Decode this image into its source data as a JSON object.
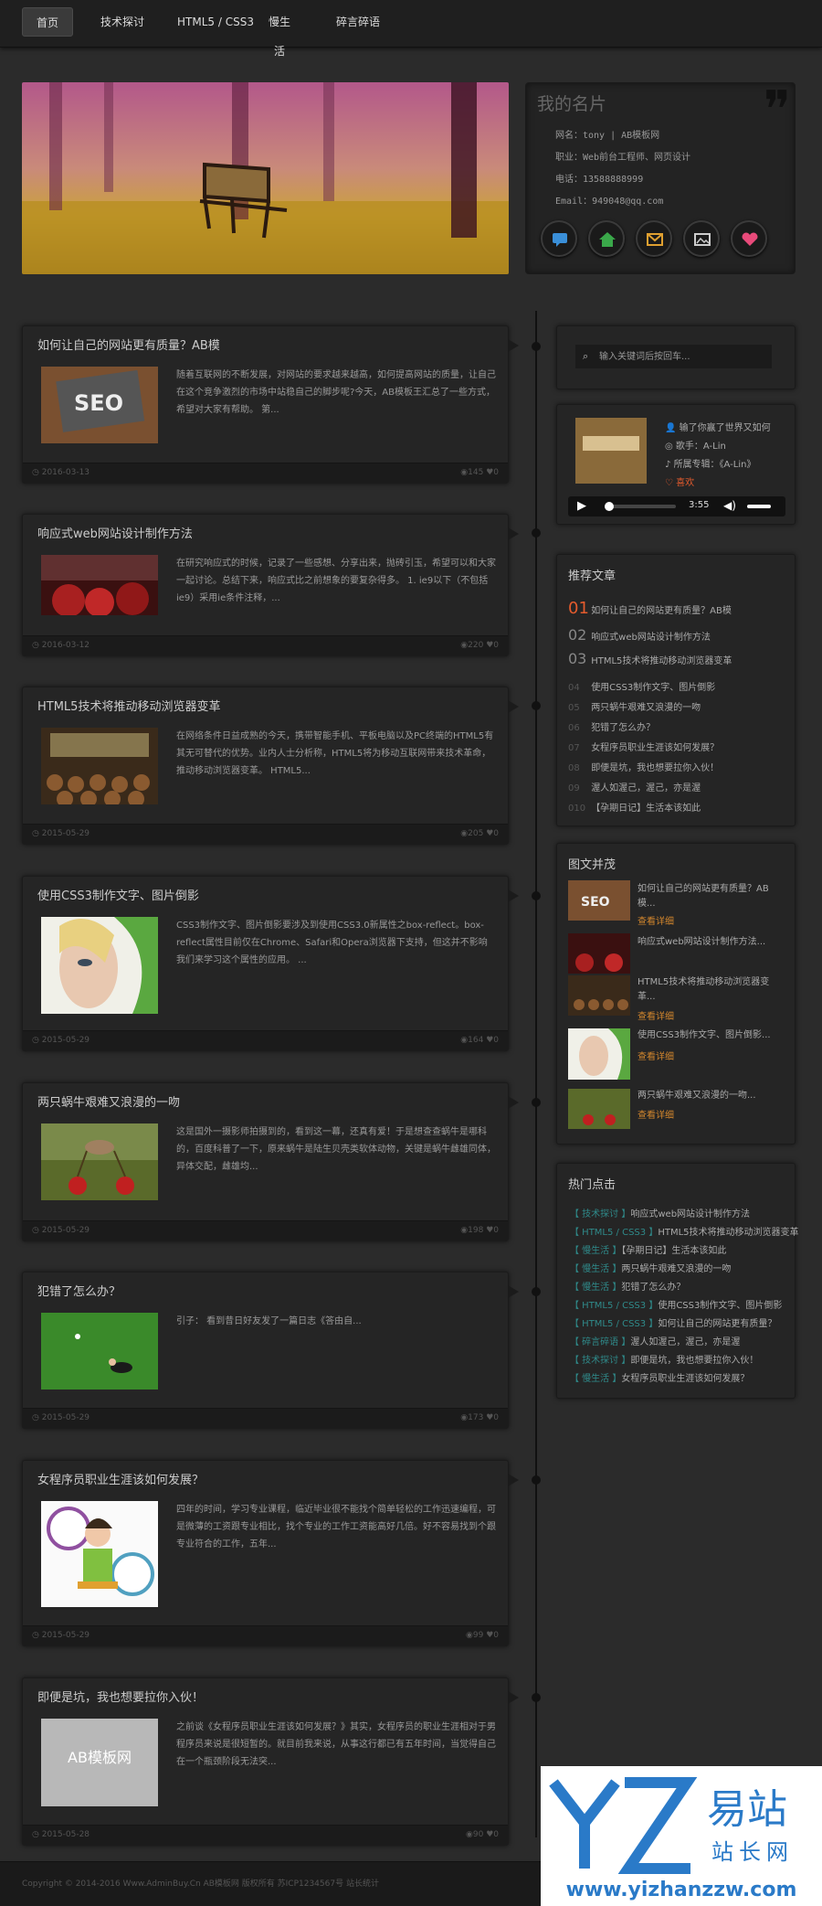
{
  "nav": {
    "items": [
      "首页",
      "技术探讨",
      "HTML5 / CSS3",
      "慢生活",
      "碎言碎语"
    ]
  },
  "profile": {
    "title": "我的名片",
    "name": "网名：tony | AB模板网",
    "job": "职业：Web前台工程师、网页设计",
    "phone": "电话：13588888999",
    "email": "Email：949048@qq.com"
  },
  "posts": [
    {
      "title": "如何让自己的网站更有质量？AB模",
      "desc": "随着互联网的不断发展，对网站的要求越来越高，如何提高网站的质量，让自己在这个竞争激烈的市场中站稳自己的脚步呢?今天，AB模板王汇总了一些方式，希望对大家有帮助。 第...",
      "date": "2016-03-13",
      "views": "145",
      "likes": "0"
    },
    {
      "title": "响应式web网站设计制作方法",
      "desc": "在研究响应式的时候，记录了一些感想、分享出来，抛砖引玉，希望可以和大家一起讨论。总结下来，响应式比之前想象的要复杂得多。 1. ie9以下（不包括ie9）采用ie条件注释，...",
      "date": "2016-03-12",
      "views": "220",
      "likes": "0"
    },
    {
      "title": "HTML5技术将推动移动浏览器变革",
      "desc": "在网络条件日益成熟的今天，携带智能手机、平板电脑以及PC终端的HTML5有其无可替代的优势。业内人士分析称，HTML5将为移动互联网带来技术革命，推动移动浏览器变革。 HTML5...",
      "date": "2015-05-29",
      "views": "205",
      "likes": "0"
    },
    {
      "title": "使用CSS3制作文字、图片倒影",
      "desc": "CSS3制作文字、图片倒影要涉及到使用CSS3.0新属性之box-reflect。box-reflect属性目前仅在Chrome、Safari和Opera浏览器下支持，但这并不影响我们来学习这个属性的应用。 ...",
      "date": "2015-05-29",
      "views": "164",
      "likes": "0"
    },
    {
      "title": "两只蜗牛艰难又浪漫的一吻",
      "desc": "这是国外一摄影师拍摄到的，看到这一幕，还真有爱！于是想查查蜗牛是哪科的，百度科普了一下，原来蜗牛是陆生贝壳类软体动物，关键是蜗牛雌雄同体，异体交配，雌雄均...",
      "date": "2015-05-29",
      "views": "198",
      "likes": "0"
    },
    {
      "title": "犯错了怎么办？",
      "desc": "引子： 看到昔日好友发了一篇日志《答由自...",
      "date": "2015-05-29",
      "views": "173",
      "likes": "0"
    },
    {
      "title": "女程序员职业生涯该如何发展？",
      "desc": "四年的时间，学习专业课程，临近毕业很不能找个简单轻松的工作迅速编程，可是微薄的工资跟专业相比，找个专业的工作工资能高好几倍。好不容易找到个跟专业符合的工作，五年...",
      "date": "2015-05-29",
      "views": "99",
      "likes": "0"
    },
    {
      "title": "即便是坑，我也想要拉你入伙！",
      "desc": "之前谈《女程序员职业生涯该如何发展？》其实，女程序员的职业生涯相对于男程序员来说是很短暂的。就目前我来说，从事这行都已有五年时间，当觉得自己在一个瓶颈阶段无法突...",
      "date": "2015-05-28",
      "views": "90",
      "likes": "0"
    }
  ],
  "search": {
    "placeholder": "输入关键词后按回车..."
  },
  "music": {
    "song": "输了你赢了世界又如何",
    "singer": "歌手：A-Lin",
    "album": "所属专辑：《A-Lin》",
    "like": "喜欢",
    "time": "3:55"
  },
  "recommend": {
    "title": "推荐文章",
    "items": [
      {
        "num": "01",
        "text": "如何让自己的网站更有质量？AB模"
      },
      {
        "num": "02",
        "text": "响应式web网站设计制作方法"
      },
      {
        "num": "03",
        "text": "HTML5技术将推动移动浏览器变革"
      },
      {
        "num": "04",
        "text": "使用CSS3制作文字、图片倒影"
      },
      {
        "num": "05",
        "text": "两只蜗牛艰难又浪漫的一吻"
      },
      {
        "num": "06",
        "text": "犯错了怎么办？"
      },
      {
        "num": "07",
        "text": "女程序员职业生涯该如何发展？"
      },
      {
        "num": "08",
        "text": "即便是坑，我也想要拉你入伙！"
      },
      {
        "num": "09",
        "text": "渥人如渥己，渥己，亦是渥"
      },
      {
        "num": "010",
        "text": "【孕期日记】生活本该如此"
      }
    ]
  },
  "picnews": {
    "title": "图文并茂",
    "more": "查看详细",
    "items": [
      "如何让自己的网站更有质量？AB模...",
      "响应式web网站设计制作方法...",
      "HTML5技术将推动移动浏览器变革...",
      "使用CSS3制作文字、图片倒影...",
      "两只蜗牛艰难又浪漫的一吻..."
    ]
  },
  "hot": {
    "title": "热门点击",
    "items": [
      {
        "cat": "【 技术探讨 】",
        "text": "响应式web网站设计制作方法"
      },
      {
        "cat": "【 HTML5 / CSS3 】",
        "text": "HTML5技术将推动移动浏览器变革"
      },
      {
        "cat": "【 慢生活 】",
        "text": "【孕期日记】生活本该如此"
      },
      {
        "cat": "【 慢生活 】",
        "text": "两只蜗牛艰难又浪漫的一吻"
      },
      {
        "cat": "【 慢生活 】",
        "text": "犯错了怎么办？"
      },
      {
        "cat": "【 HTML5 / CSS3 】",
        "text": "使用CSS3制作文字、图片倒影"
      },
      {
        "cat": "【 HTML5 / CSS3 】",
        "text": "如何让自己的网站更有质量？"
      },
      {
        "cat": "【 碎言碎语 】",
        "text": "渥人如渥己，渥己，亦是渥"
      },
      {
        "cat": "【 技术探讨 】",
        "text": "即便是坑，我也想要拉你入伙！"
      },
      {
        "cat": "【 慢生活 】",
        "text": "女程序员职业生涯该如何发展？"
      }
    ]
  },
  "footer": {
    "text": "Copyright © 2014-2016 Www.AdminBuy.Cn AB模板网 版权所有 苏ICP1234567号 站长统计"
  },
  "watermark": {
    "big": "易站",
    "small": "站长网",
    "url": "www.yizhanzzw.com",
    "logo": "YZ"
  },
  "colors": {
    "accent": "#e45b2d",
    "more": "#d2862d",
    "cat": "#2f8a8a"
  }
}
